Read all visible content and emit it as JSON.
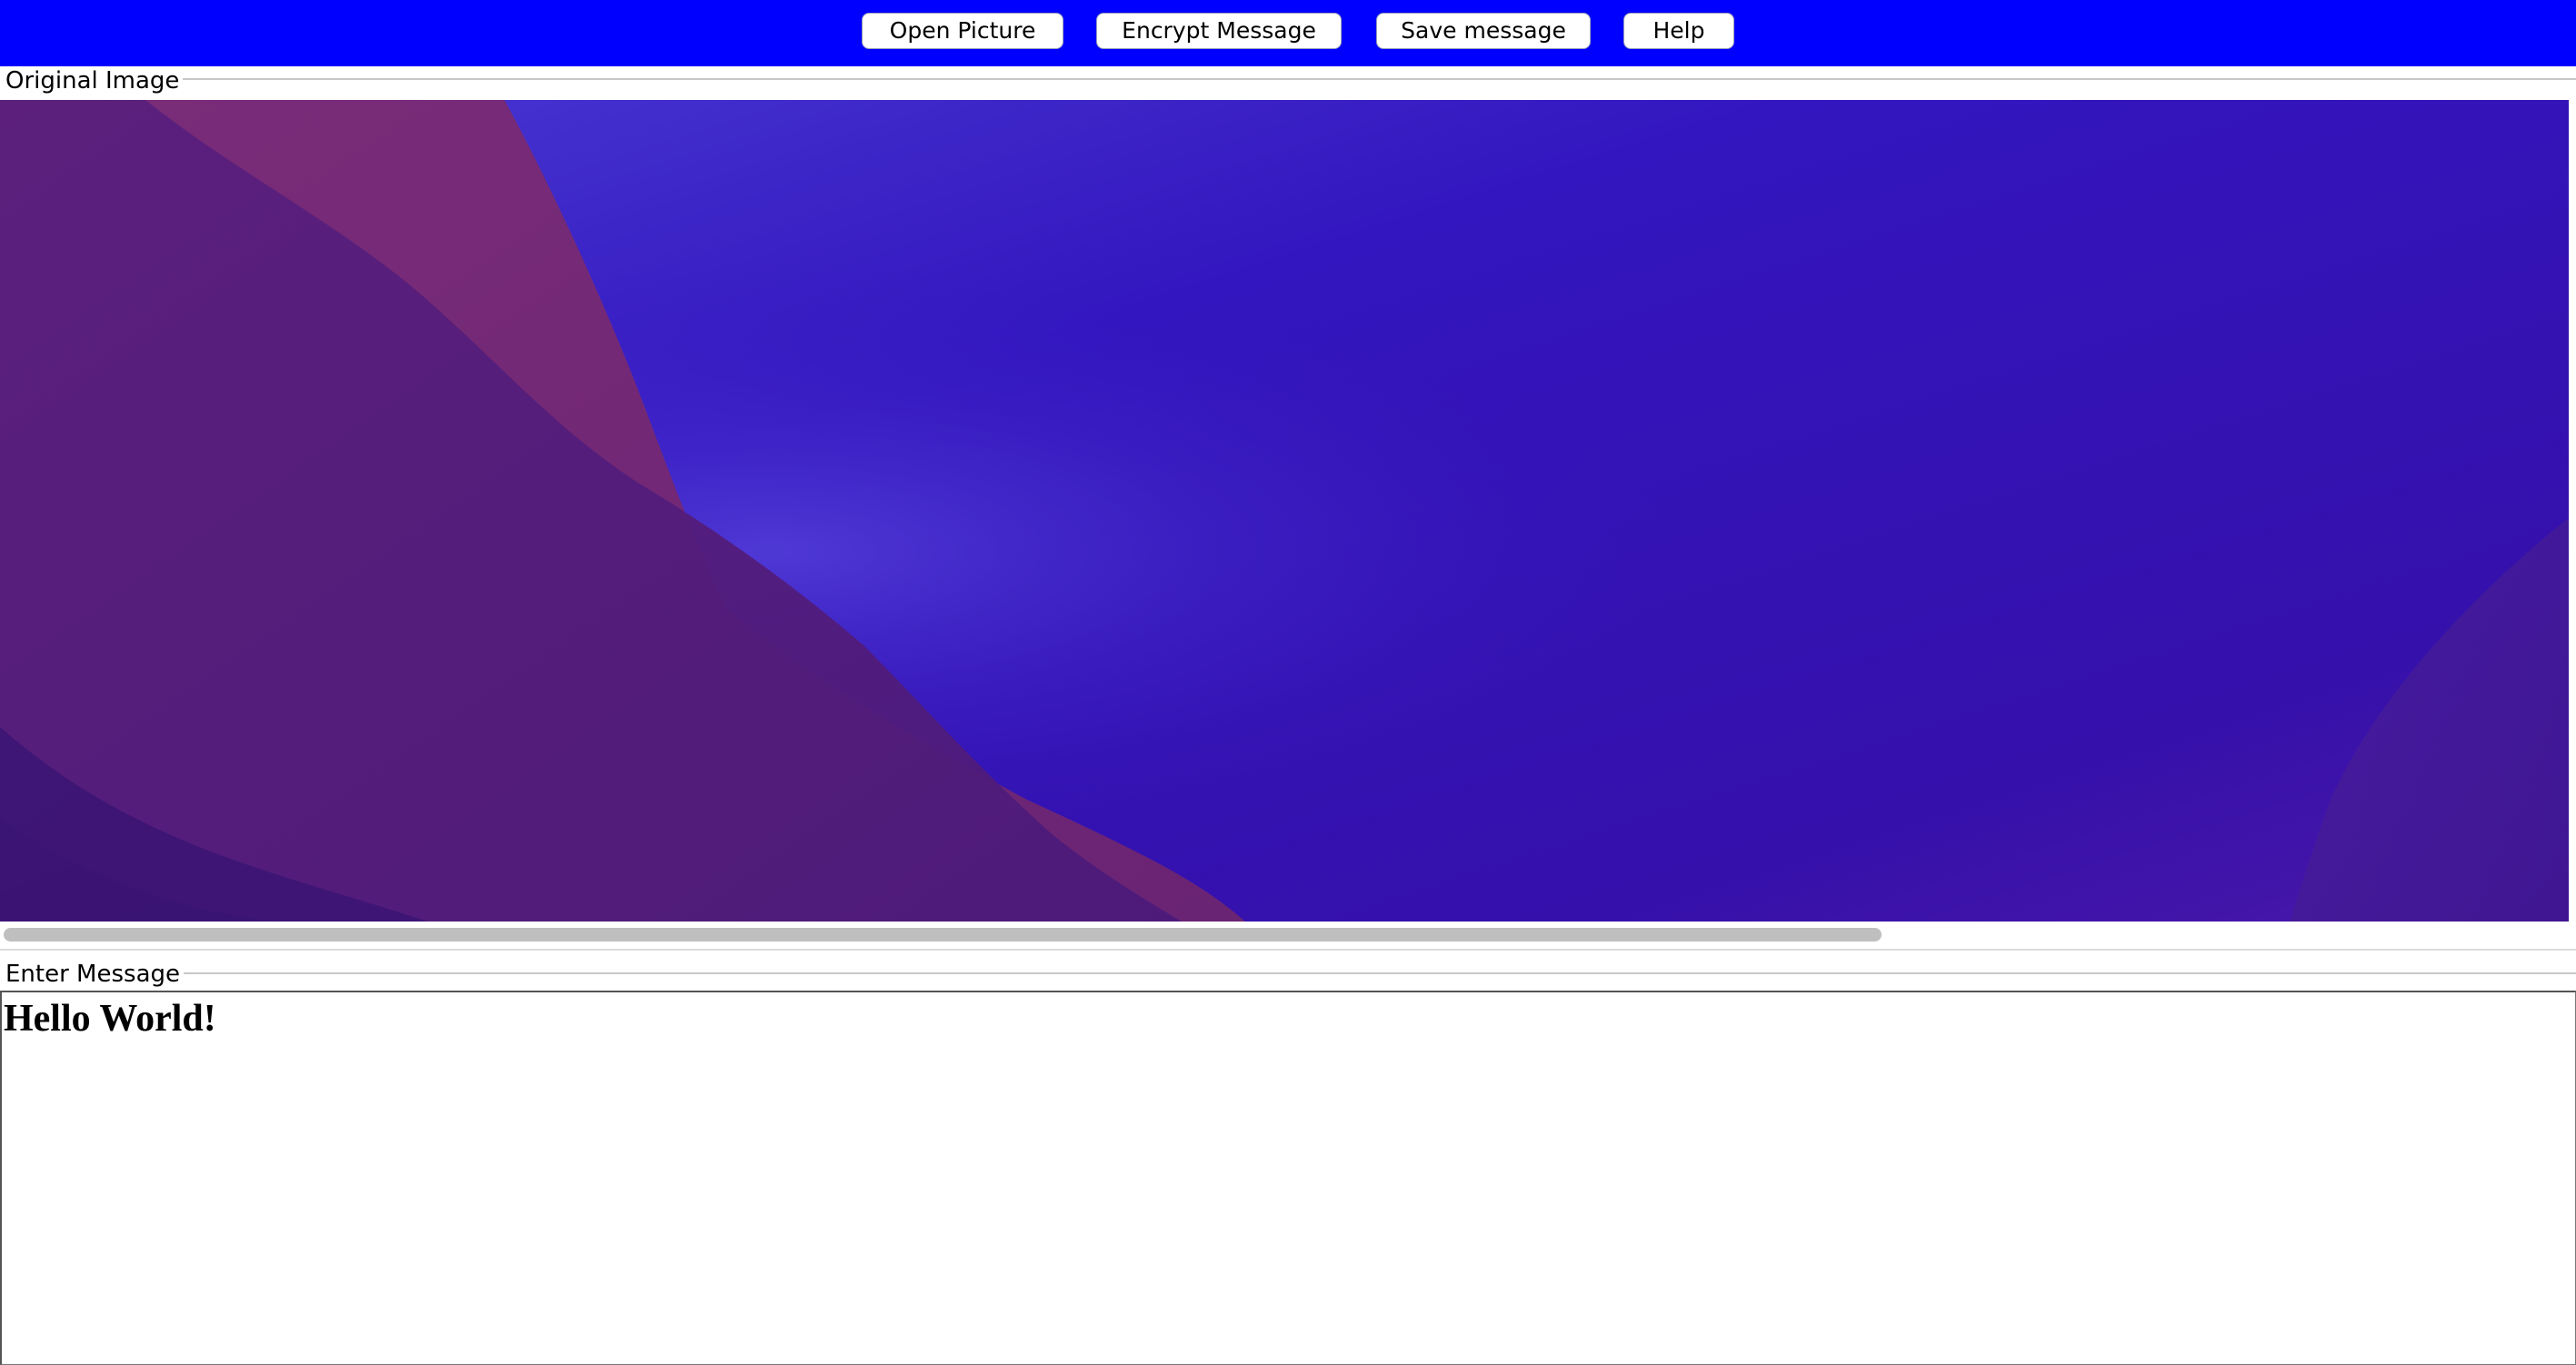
{
  "toolbar": {
    "background": "#0000ff",
    "buttons": [
      {
        "id": "open_picture",
        "label": "Open Picture"
      },
      {
        "id": "encrypt_message",
        "label": "Encrypt Message"
      },
      {
        "id": "save_message",
        "label": "Save message"
      },
      {
        "id": "help",
        "label": "Help"
      }
    ]
  },
  "original_image": {
    "title": "Original Image",
    "image_palette": {
      "base": "#3313b8",
      "upper_left_wave": "#6e2a78",
      "left_wave": "#53207a",
      "lower_left": "#33126a"
    },
    "scrollbar": {
      "orientation": "horizontal",
      "thumb_color": "#bfbfbf"
    }
  },
  "message": {
    "title": "Enter Message",
    "value": "Hello World!"
  }
}
